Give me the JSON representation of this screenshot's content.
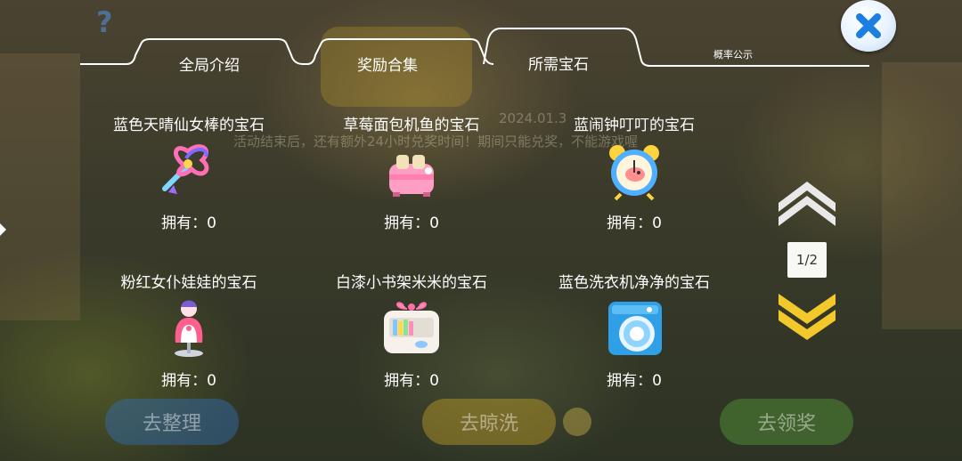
{
  "tabs": [
    {
      "label": "全局介绍",
      "active": false
    },
    {
      "label": "奖励合集",
      "active": false
    },
    {
      "label": "所需宝石",
      "active": true
    },
    {
      "label": "概率公示",
      "active": false
    }
  ],
  "background": {
    "notice": "活动结束后，还有额外24小时兑奖时间！期间只能兑奖，不能游戏喔",
    "date": "2024.01.3",
    "buttons": [
      "去整理",
      "去晾洗",
      "去领奖"
    ]
  },
  "gems": [
    {
      "name": "蓝色天晴仙女棒的宝石",
      "owned": "拥有：0",
      "icon": "fairy-wand-icon"
    },
    {
      "name": "草莓面包机鱼的宝石",
      "owned": "拥有：0",
      "icon": "toaster-icon"
    },
    {
      "name": "蓝闹钟叮叮的宝石",
      "owned": "拥有：0",
      "icon": "alarm-clock-icon"
    },
    {
      "name": "粉红女仆娃娃的宝石",
      "owned": "拥有：0",
      "icon": "maid-doll-icon"
    },
    {
      "name": "白漆小书架米米的宝石",
      "owned": "拥有：0",
      "icon": "bookshelf-icon"
    },
    {
      "name": "蓝色洗衣机净净的宝石",
      "owned": "拥有：0",
      "icon": "washing-machine-icon"
    }
  ],
  "pager": {
    "label": "1/2",
    "current": 1,
    "total": 2
  },
  "colors": {
    "tab_line": "#ffffff",
    "close_x": "#1a7fe0",
    "pager_up": "#e9e9e9",
    "pager_down": "#f2c82a"
  }
}
